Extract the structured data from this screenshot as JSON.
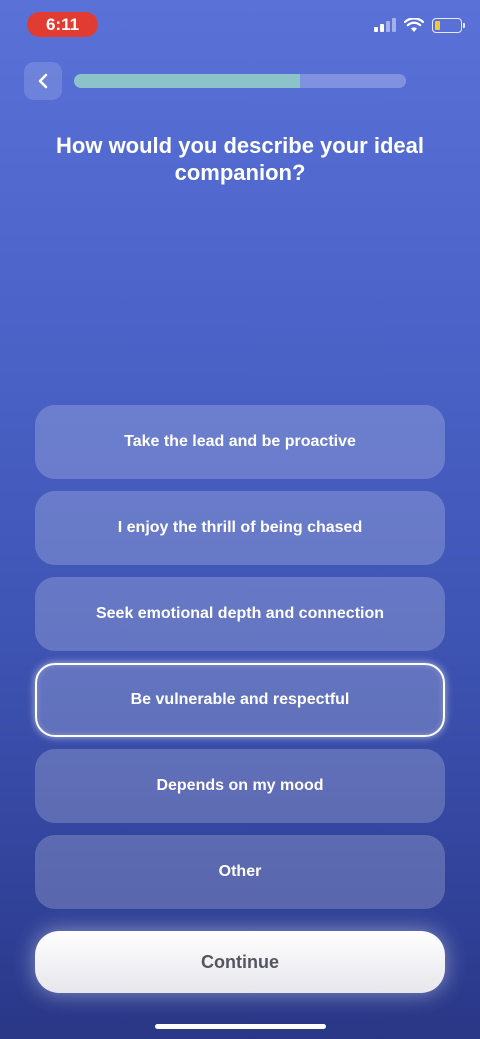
{
  "status_bar": {
    "time": "6:11"
  },
  "progress": {
    "fraction": 0.68
  },
  "question": "How would you describe your ideal companion?",
  "options": [
    {
      "label": "Take the lead and be proactive",
      "selected": false
    },
    {
      "label": "I enjoy the thrill of being chased",
      "selected": false
    },
    {
      "label": "Seek emotional depth and connection",
      "selected": false
    },
    {
      "label": "Be vulnerable and respectful",
      "selected": true
    },
    {
      "label": "Depends on my mood",
      "selected": false
    },
    {
      "label": "Other",
      "selected": false
    }
  ],
  "continue_label": "Continue",
  "icons": {
    "back": "chevron-left-icon",
    "signal": "cellular-signal-icon",
    "wifi": "wifi-icon",
    "battery": "battery-low-icon"
  },
  "colors": {
    "time_pill": "#e23b32",
    "progress_fill": "#8bc3c8",
    "battery_fill": "#f3c63b"
  }
}
